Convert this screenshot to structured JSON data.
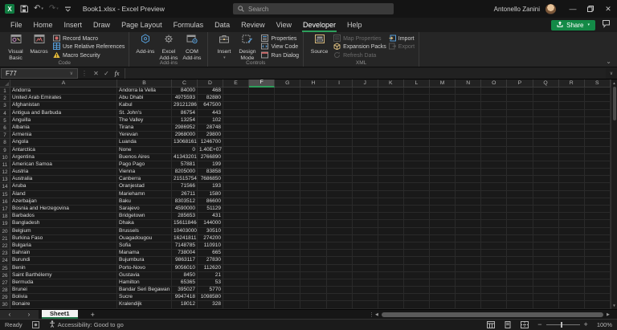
{
  "titlebar": {
    "title": "Book1.xlsx - Excel Preview",
    "search_placeholder": "Search",
    "user_name": "Antonello Zanini"
  },
  "tabs": {
    "items": [
      "File",
      "Home",
      "Insert",
      "Draw",
      "Page Layout",
      "Formulas",
      "Data",
      "Review",
      "View",
      "Developer",
      "Help"
    ],
    "active": "Developer"
  },
  "share": {
    "label": "Share"
  },
  "ribbon": {
    "code": {
      "label": "Code",
      "visual_basic": "Visual Basic",
      "macros": "Macros",
      "record_macro": "Record Macro",
      "use_relative_references": "Use Relative References",
      "macro_security": "Macro Security"
    },
    "addins": {
      "label": "Add-ins",
      "add_ins": "Add-ins",
      "excel_add_ins": "Excel Add-ins",
      "com_add_ins": "COM Add-ins"
    },
    "controls": {
      "label": "Controls",
      "insert": "Insert",
      "design_mode": "Design Mode",
      "properties": "Properties",
      "view_code": "View Code",
      "run_dialog": "Run Dialog"
    },
    "xml": {
      "label": "XML",
      "source": "Source",
      "map_properties": "Map Properties",
      "expansion_packs": "Expansion Packs",
      "refresh_data": "Refresh Data",
      "import": "Import",
      "export": "Export"
    }
  },
  "formula_bar": {
    "name_box": "F77",
    "fx_label": "fx",
    "value": ""
  },
  "grid": {
    "columns": [
      "A",
      "B",
      "C",
      "D",
      "E",
      "F",
      "G",
      "H",
      "I",
      "J",
      "K",
      "L",
      "M",
      "N",
      "O",
      "P",
      "Q",
      "R",
      "S"
    ],
    "selected_column": "F",
    "rows": [
      [
        "Andorra",
        "Andorra la Vella",
        "84000",
        "468"
      ],
      [
        "United Arab Emirates",
        "Abu Dhabi",
        "4975593",
        "82880"
      ],
      [
        "Afghanistan",
        "Kabul",
        "29121286",
        "647500"
      ],
      [
        "Antigua and Barbuda",
        "St. John's",
        "86754",
        "443"
      ],
      [
        "Anguilla",
        "The Valley",
        "13254",
        "102"
      ],
      [
        "Albania",
        "Tirana",
        "2986952",
        "28748"
      ],
      [
        "Armenia",
        "Yerevan",
        "2968000",
        "29800"
      ],
      [
        "Angola",
        "Luanda",
        "13068161",
        "1246700"
      ],
      [
        "Antarctica",
        "None",
        "0",
        "1.40E+07"
      ],
      [
        "Argentina",
        "Buenos Aires",
        "41343201",
        "2766890"
      ],
      [
        "American Samoa",
        "Pago Pago",
        "57881",
        "199"
      ],
      [
        "Austria",
        "Vienna",
        "8205000",
        "83858"
      ],
      [
        "Australia",
        "Canberra",
        "21515754",
        "7686850"
      ],
      [
        "Aruba",
        "Oranjestad",
        "71566",
        "193"
      ],
      [
        "Åland",
        "Mariehamn",
        "26711",
        "1580"
      ],
      [
        "Azerbaijan",
        "Baku",
        "8303512",
        "86600"
      ],
      [
        "Bosnia and Herzegovina",
        "Sarajevo",
        "4590000",
        "51129"
      ],
      [
        "Barbados",
        "Bridgetown",
        "285653",
        "431"
      ],
      [
        "Bangladesh",
        "Dhaka",
        "156118464",
        "144000"
      ],
      [
        "Belgium",
        "Brussels",
        "10403000",
        "30510"
      ],
      [
        "Burkina Faso",
        "Ouagadougou",
        "16241811",
        "274200"
      ],
      [
        "Bulgaria",
        "Sofia",
        "7148785",
        "110910"
      ],
      [
        "Bahrain",
        "Manama",
        "738004",
        "665"
      ],
      [
        "Burundi",
        "Bujumbura",
        "9863117",
        "27830"
      ],
      [
        "Benin",
        "Porto-Novo",
        "9056010",
        "112620"
      ],
      [
        "Saint Barthélemy",
        "Gustavia",
        "8450",
        "21"
      ],
      [
        "Bermuda",
        "Hamilton",
        "65365",
        "53"
      ],
      [
        "Brunei",
        "Bandar Seri Begawan",
        "395027",
        "5770"
      ],
      [
        "Bolivia",
        "Sucre",
        "9947418",
        "1098580"
      ],
      [
        "Bonaire",
        "Kralendijk",
        "18012",
        "328"
      ]
    ]
  },
  "sheetbar": {
    "sheet_name": "Sheet1"
  },
  "statusbar": {
    "ready": "Ready",
    "accessibility": "Accessibility: Good to go",
    "zoom": "100%"
  }
}
